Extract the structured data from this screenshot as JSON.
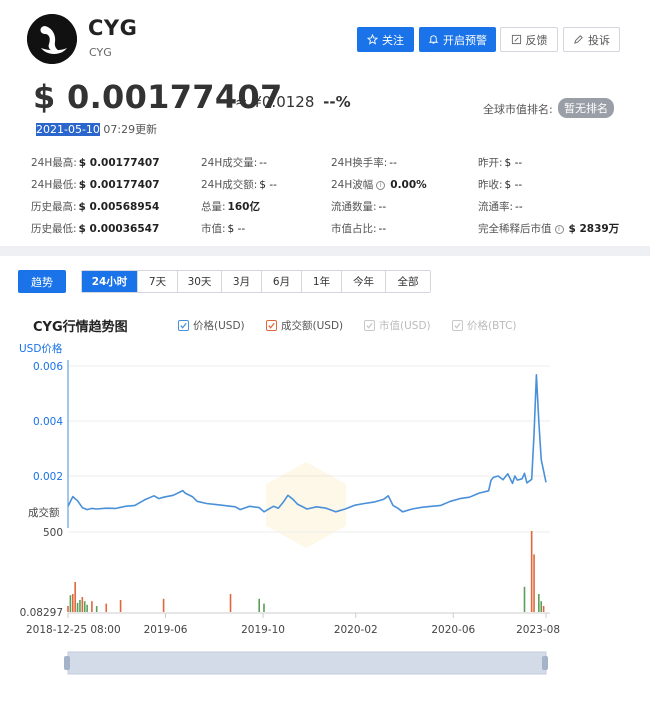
{
  "coin": {
    "name": "CYG",
    "symbol": "CYG"
  },
  "actions": {
    "follow": "关注",
    "alert": "开启预警",
    "feedback": "反馈",
    "complain": "投诉"
  },
  "price": {
    "usd": "$ 0.00177407",
    "approx": "≈ ¥",
    "cny_value": "0.0128",
    "change": "--%"
  },
  "update": {
    "date": "2021-05-10",
    "time": " 07:29更新"
  },
  "rank": {
    "label": "全球市值排名:",
    "badge": "暂无排名"
  },
  "stats": [
    [
      {
        "label": "24H最高:",
        "value": "$ 0.00177407",
        "bold": true
      },
      {
        "label": "24H成交量:",
        "value": "--",
        "bold": false
      },
      {
        "label": "24H换手率:",
        "value": "--",
        "bold": false
      },
      {
        "label": "昨开:",
        "value": "$ --",
        "bold": false
      }
    ],
    [
      {
        "label": "24H最低:",
        "value": "$ 0.00177407",
        "bold": true
      },
      {
        "label": "24H成交额:",
        "value": "$ --",
        "bold": false
      },
      {
        "label": "24H波幅",
        "value": "0.00%",
        "bold": true,
        "info": true
      },
      {
        "label": "昨收:",
        "value": "$ --",
        "bold": false
      }
    ],
    [
      {
        "label": "历史最高:",
        "value": "$ 0.00568954",
        "bold": true
      },
      {
        "label": "总量:",
        "value": "160亿",
        "bold": true
      },
      {
        "label": "流通数量:",
        "value": "--",
        "bold": false
      },
      {
        "label": "流通率:",
        "value": "--",
        "bold": false
      }
    ],
    [
      {
        "label": "历史最低:",
        "value": "$ 0.00036547",
        "bold": true
      },
      {
        "label": "市值:",
        "value": "$ --",
        "bold": false
      },
      {
        "label": "市值占比:",
        "value": "--",
        "bold": false
      },
      {
        "label": "完全稀释后市值",
        "value": "$ 2839万",
        "bold": true,
        "info": true
      }
    ]
  ],
  "tabs": {
    "trend": "趋势",
    "ranges": [
      "24小时",
      "7天",
      "30天",
      "3月",
      "6月",
      "1年",
      "今年",
      "全部"
    ],
    "active_range": 0
  },
  "chart_title": "CYG行情趋势图",
  "legend": [
    {
      "label": "价格(USD)",
      "checked": true,
      "color": "#4a90d9",
      "enabled": true
    },
    {
      "label": "成交额(USD)",
      "checked": true,
      "color": "#e0673b",
      "enabled": true
    },
    {
      "label": "市值(USD)",
      "checked": true,
      "color": "#c8c8c8",
      "enabled": false
    },
    {
      "label": "价格(BTC)",
      "checked": true,
      "color": "#c8c8c8",
      "enabled": false
    }
  ],
  "colors": {
    "accent": "#1a73e8",
    "price_line": "#4a90d9",
    "volume_orange": "#e0673b",
    "volume_green": "#5a9e5a"
  },
  "chart_data": {
    "type": "line",
    "price_axis": {
      "label": "USD价格",
      "ticks": [
        "0.006",
        "0.004",
        "0.002"
      ],
      "ylim": [
        0,
        0.006
      ]
    },
    "volume_axis": {
      "label": "成交额",
      "ticks": [
        "500",
        "0.08297"
      ],
      "scale": "log"
    },
    "x_ticks": [
      "2018-12-25 08:00",
      "2019-06",
      "2019-10",
      "2020-02",
      "2020-06",
      "2023-08"
    ],
    "series": [
      {
        "name": "价格(USD)",
        "points": [
          [
            0.0,
            0.0009
          ],
          [
            0.01,
            0.00125
          ],
          [
            0.02,
            0.0011
          ],
          [
            0.03,
            0.00085
          ],
          [
            0.04,
            0.00078
          ],
          [
            0.05,
            0.00082
          ],
          [
            0.06,
            0.0008
          ],
          [
            0.08,
            0.00083
          ],
          [
            0.1,
            0.00082
          ],
          [
            0.12,
            0.0009
          ],
          [
            0.14,
            0.00093
          ],
          [
            0.16,
            0.00113
          ],
          [
            0.18,
            0.00128
          ],
          [
            0.19,
            0.00118
          ],
          [
            0.2,
            0.00123
          ],
          [
            0.22,
            0.0013
          ],
          [
            0.24,
            0.00147
          ],
          [
            0.245,
            0.00138
          ],
          [
            0.26,
            0.00125
          ],
          [
            0.27,
            0.00108
          ],
          [
            0.29,
            0.001
          ],
          [
            0.31,
            0.00096
          ],
          [
            0.33,
            0.00092
          ],
          [
            0.35,
            0.00088
          ],
          [
            0.36,
            0.00078
          ],
          [
            0.38,
            0.0009
          ],
          [
            0.4,
            0.00085
          ],
          [
            0.41,
            0.0007
          ],
          [
            0.43,
            0.0009
          ],
          [
            0.44,
            0.00083
          ],
          [
            0.45,
            0.00104
          ],
          [
            0.46,
            0.0013
          ],
          [
            0.47,
            0.00116
          ],
          [
            0.48,
            0.00098
          ],
          [
            0.5,
            0.0008
          ],
          [
            0.52,
            0.00088
          ],
          [
            0.54,
            0.00083
          ],
          [
            0.56,
            0.0007
          ],
          [
            0.58,
            0.0008
          ],
          [
            0.6,
            0.00094
          ],
          [
            0.62,
            0.001
          ],
          [
            0.64,
            0.00105
          ],
          [
            0.66,
            0.00115
          ],
          [
            0.67,
            0.00128
          ],
          [
            0.68,
            0.00093
          ],
          [
            0.69,
            0.00083
          ],
          [
            0.7,
            0.0007
          ],
          [
            0.72,
            0.0008
          ],
          [
            0.74,
            0.00086
          ],
          [
            0.76,
            0.0009
          ],
          [
            0.78,
            0.00093
          ],
          [
            0.8,
            0.00108
          ],
          [
            0.82,
            0.00118
          ],
          [
            0.84,
            0.00123
          ],
          [
            0.86,
            0.00138
          ],
          [
            0.88,
            0.00146
          ],
          [
            0.885,
            0.00184
          ],
          [
            0.89,
            0.00195
          ],
          [
            0.9,
            0.002
          ],
          [
            0.91,
            0.00186
          ],
          [
            0.92,
            0.00208
          ],
          [
            0.93,
            0.00173
          ],
          [
            0.935,
            0.002
          ],
          [
            0.94,
            0.00185
          ],
          [
            0.95,
            0.0019
          ],
          [
            0.955,
            0.0021
          ],
          [
            0.96,
            0.00175
          ],
          [
            0.97,
            0.00188
          ],
          [
            0.975,
            0.0035
          ],
          [
            0.98,
            0.00568
          ],
          [
            0.985,
            0.004
          ],
          [
            0.99,
            0.0026
          ],
          [
            1.0,
            0.00177
          ]
        ]
      },
      {
        "name": "成交额(USD)",
        "bars": [
          [
            0.0,
            10,
            "o"
          ],
          [
            0.005,
            28,
            "g"
          ],
          [
            0.01,
            30,
            "o"
          ],
          [
            0.015,
            50,
            "o"
          ],
          [
            0.02,
            15,
            "g"
          ],
          [
            0.025,
            20,
            "g"
          ],
          [
            0.03,
            25,
            "o"
          ],
          [
            0.035,
            18,
            "g"
          ],
          [
            0.04,
            12,
            "g"
          ],
          [
            0.05,
            18,
            "o"
          ],
          [
            0.06,
            10,
            "g"
          ],
          [
            0.08,
            14,
            "o"
          ],
          [
            0.11,
            20,
            "o"
          ],
          [
            0.2,
            22,
            "o"
          ],
          [
            0.34,
            30,
            "o"
          ],
          [
            0.4,
            22,
            "g"
          ],
          [
            0.41,
            14,
            "g"
          ],
          [
            0.955,
            42,
            "g"
          ],
          [
            0.97,
            135,
            "o"
          ],
          [
            0.975,
            96,
            "o"
          ],
          [
            0.985,
            30,
            "g"
          ],
          [
            0.99,
            18,
            "g"
          ],
          [
            0.995,
            10,
            "o"
          ]
        ]
      }
    ],
    "watermark": true,
    "grid": "horizontal"
  }
}
